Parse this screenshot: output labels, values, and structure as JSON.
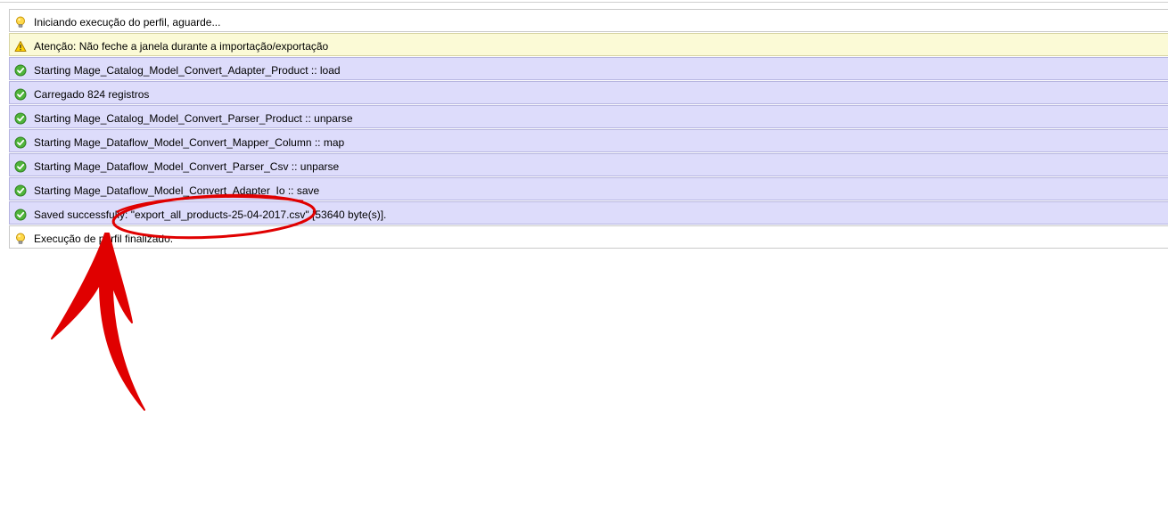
{
  "colors": {
    "info_bg": "#ffffff",
    "warning_bg": "#fbfad6",
    "success_bg": "#dddcfb",
    "annotation_red": "#e00000"
  },
  "log": [
    {
      "type": "info",
      "icon": "lightbulb-icon",
      "text": "Iniciando execução do perfil, aguarde..."
    },
    {
      "type": "warning",
      "icon": "warning-icon",
      "text": "Atenção: Não feche a janela durante a importação/exportação"
    },
    {
      "type": "success",
      "icon": "check-circle-icon",
      "text": "Starting Mage_Catalog_Model_Convert_Adapter_Product :: load"
    },
    {
      "type": "success",
      "icon": "check-circle-icon",
      "text": "Carregado 824 registros"
    },
    {
      "type": "success",
      "icon": "check-circle-icon",
      "text": "Starting Mage_Catalog_Model_Convert_Parser_Product :: unparse"
    },
    {
      "type": "success",
      "icon": "check-circle-icon",
      "text": "Starting Mage_Dataflow_Model_Convert_Mapper_Column :: map"
    },
    {
      "type": "success",
      "icon": "check-circle-icon",
      "text": "Starting Mage_Dataflow_Model_Convert_Parser_Csv :: unparse"
    },
    {
      "type": "success",
      "icon": "check-circle-icon",
      "text": "Starting Mage_Dataflow_Model_Convert_Adapter_Io :: save"
    },
    {
      "type": "success",
      "icon": "check-circle-icon",
      "text": "Saved successfully: \"export_all_products-25-04-2017.csv\" [53640 byte(s)]."
    },
    {
      "type": "info",
      "icon": "lightbulb-icon",
      "text": "Execução de perfil finalizado."
    }
  ]
}
